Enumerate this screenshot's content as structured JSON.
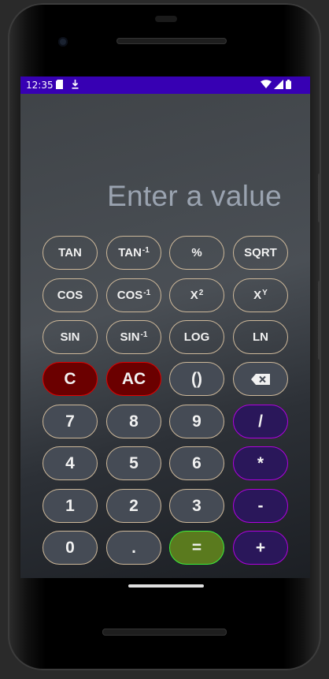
{
  "status_bar": {
    "time": "12:35",
    "bg": "#3700b3"
  },
  "display": {
    "placeholder": "Enter a value"
  },
  "keys": {
    "tan": "TAN",
    "atan": "TAN",
    "percent": "%",
    "sqrt": "SQRT",
    "cos": "COS",
    "acos": "COS",
    "square": "X",
    "power": "X",
    "sin": "SIN",
    "asin": "SIN",
    "log": "LOG",
    "ln": "LN",
    "clear": "C",
    "all_clear": "AC",
    "parens": "()",
    "seven": "7",
    "eight": "8",
    "nine": "9",
    "divide": "/",
    "four": "4",
    "five": "5",
    "six": "6",
    "multiply": "*",
    "one": "1",
    "two": "2",
    "three": "3",
    "subtract": "-",
    "zero": "0",
    "dot": ".",
    "equals": "=",
    "add": "+"
  },
  "superscripts": {
    "inverse": "-1",
    "square": "2",
    "power": "Y"
  },
  "icons": {
    "backspace": "backspace-icon"
  },
  "colors": {
    "number_key": "#454b55",
    "clear_key": "#6b0000",
    "operator_key": "#2a175a",
    "equals_key": "#5a7a1e"
  }
}
